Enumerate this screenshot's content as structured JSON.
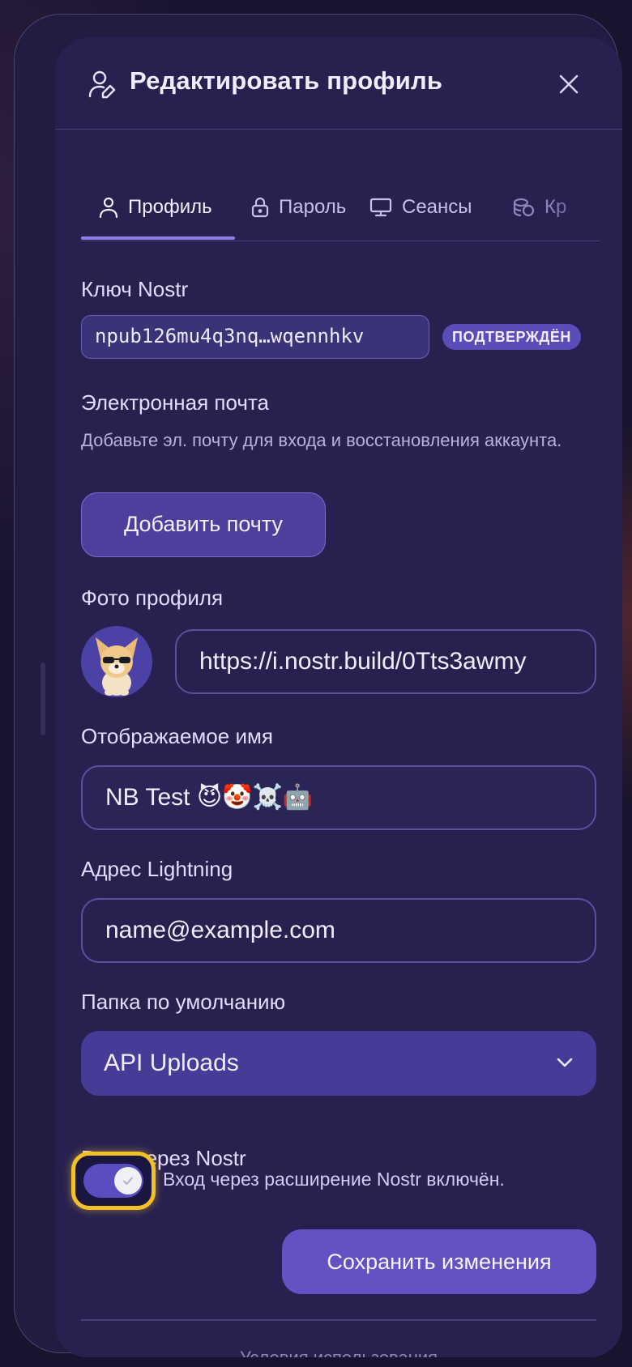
{
  "header": {
    "title": "Редактировать профиль",
    "icon": "user-edit-icon",
    "close_icon": "close-icon"
  },
  "tabs": [
    {
      "label": "Профиль",
      "icon": "user-icon",
      "active": true
    },
    {
      "label": "Пароль",
      "icon": "lock-icon",
      "active": false
    },
    {
      "label": "Сеансы",
      "icon": "monitor-icon",
      "active": false
    },
    {
      "label": "Кр",
      "icon": "coins-icon",
      "active": false
    }
  ],
  "nostr_key": {
    "label": "Ключ Nostr",
    "value": "npub126mu4q3nq…wqennhkv",
    "badge": "ПОДТВЕРЖДЁН"
  },
  "email": {
    "label": "Электронная почта",
    "help": "Добавьте эл. почту для входа и восстановления аккаунта.",
    "button": "Добавить почту"
  },
  "photo": {
    "label": "Фото профиля",
    "url": "https://i.nostr.build/0Tts3awmy"
  },
  "display_name": {
    "label": "Отображаемое имя",
    "value": "NB Test 😈🤡☠️🤖"
  },
  "lightning": {
    "label": "Адрес Lightning",
    "placeholder": "name@example.com"
  },
  "folder": {
    "label": "Папка по умолчанию",
    "selected": "API Uploads"
  },
  "nostr_login": {
    "label": "Вход через Nostr",
    "enabled": true,
    "status_text": "Вход через расширение Nostr включён."
  },
  "save_button": "Сохранить изменения",
  "footer": {
    "terms": "Условия использования"
  },
  "colors": {
    "accent": "#6550c4",
    "focus_ring": "#f2c029",
    "background": "#282150"
  }
}
